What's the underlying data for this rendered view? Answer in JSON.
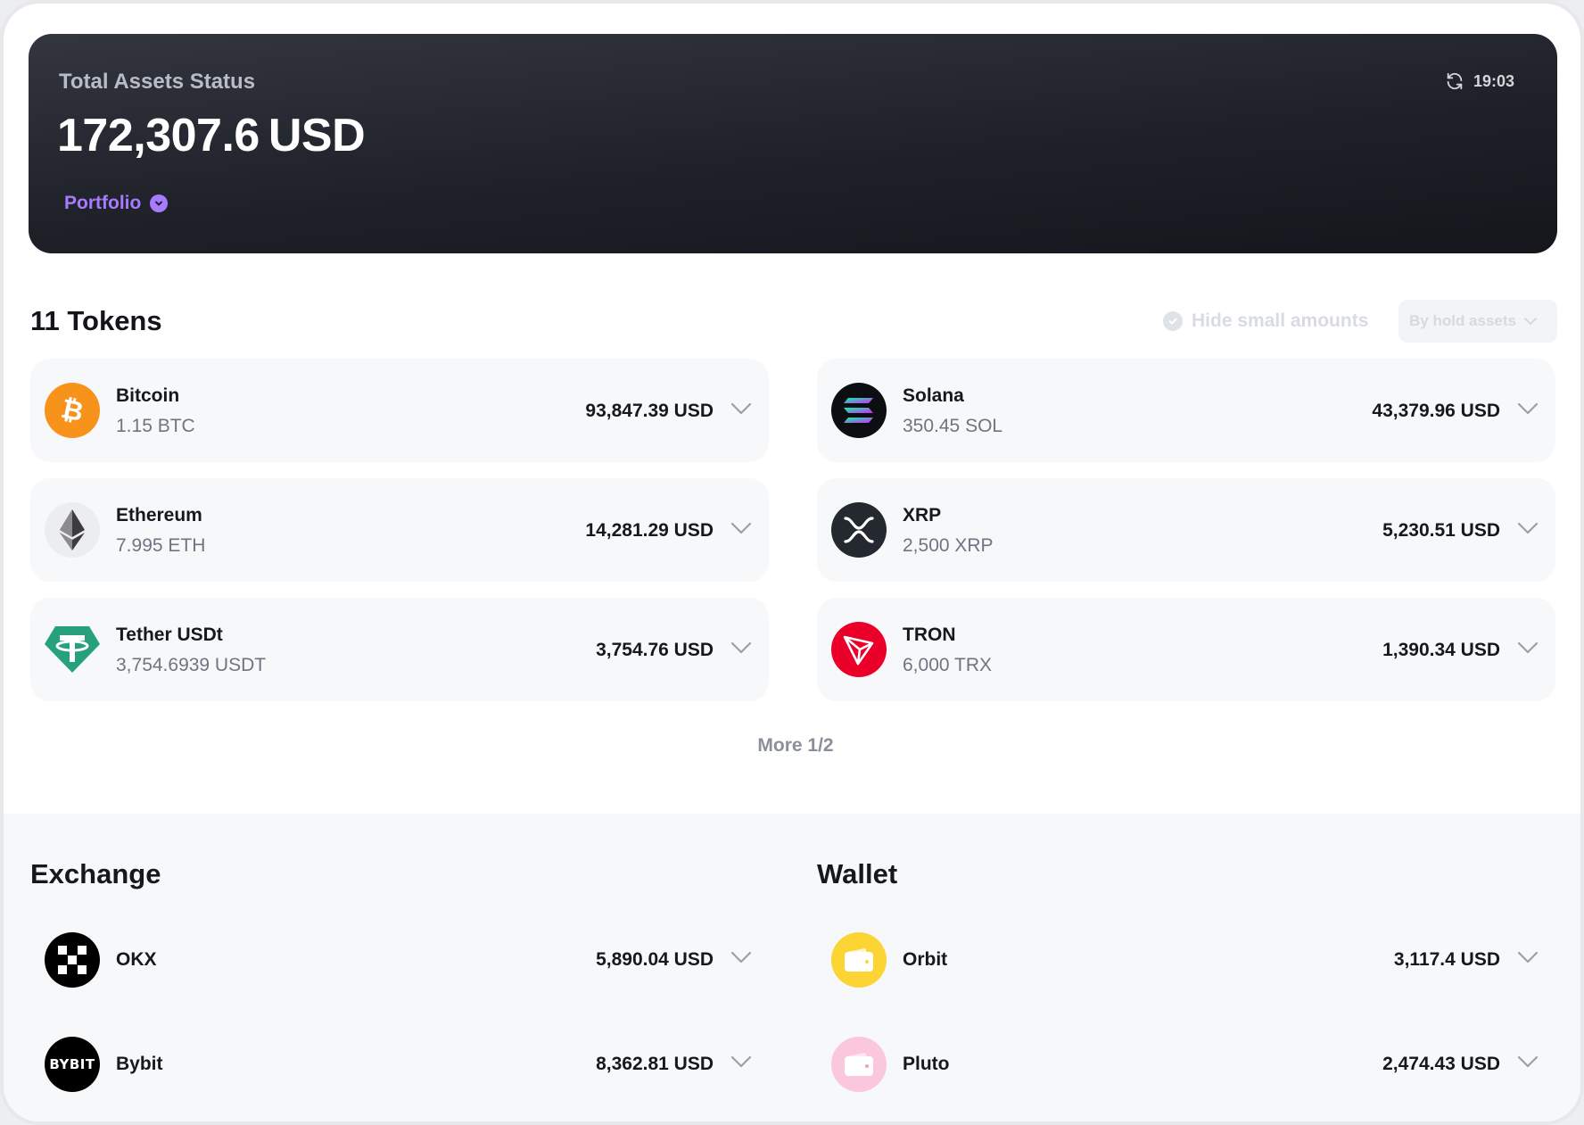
{
  "header": {
    "label": "Total Assets Status",
    "amount": "172,307.6",
    "currency": "USD",
    "portfolio_label": "Portfolio",
    "refresh_time": "19:03"
  },
  "tokens": {
    "title": "11 Tokens",
    "hide_small_label": "Hide small amounts",
    "sort_value": "By hold assets",
    "more_label": "More 1/2",
    "items": [
      {
        "name": "Bitcoin",
        "amount": "1.15 BTC",
        "value": "93,847.39 USD",
        "icon": "bitcoin-icon"
      },
      {
        "name": "Solana",
        "amount": "350.45 SOL",
        "value": "43,379.96 USD",
        "icon": "solana-icon"
      },
      {
        "name": "Ethereum",
        "amount": "7.995 ETH",
        "value": "14,281.29 USD",
        "icon": "ethereum-icon"
      },
      {
        "name": "XRP",
        "amount": "2,500 XRP",
        "value": "5,230.51 USD",
        "icon": "xrp-icon"
      },
      {
        "name": "Tether USDt",
        "amount": "3,754.6939 USDT",
        "value": "3,754.76 USD",
        "icon": "tether-icon"
      },
      {
        "name": "TRON",
        "amount": "6,000 TRX",
        "value": "1,390.34 USD",
        "icon": "tron-icon"
      }
    ]
  },
  "exchange": {
    "title": "Exchange",
    "items": [
      {
        "name": "OKX",
        "value": "5,890.04 USD",
        "icon": "okx-icon"
      },
      {
        "name": "Bybit",
        "value": "8,362.81 USD",
        "icon": "bybit-icon",
        "logo_text": "BYBIT"
      }
    ]
  },
  "wallet": {
    "title": "Wallet",
    "items": [
      {
        "name": "Orbit",
        "value": "3,117.4 USD",
        "icon": "wallet-icon"
      },
      {
        "name": "Pluto",
        "value": "2,474.43 USD",
        "icon": "wallet-icon"
      }
    ]
  },
  "colors": {
    "accent": "#a77bff",
    "bitcoin": "#f7931a",
    "tether": "#26a17b",
    "tron": "#eb0029",
    "orbit": "#fcd535",
    "pluto": "#fbc7dd"
  }
}
